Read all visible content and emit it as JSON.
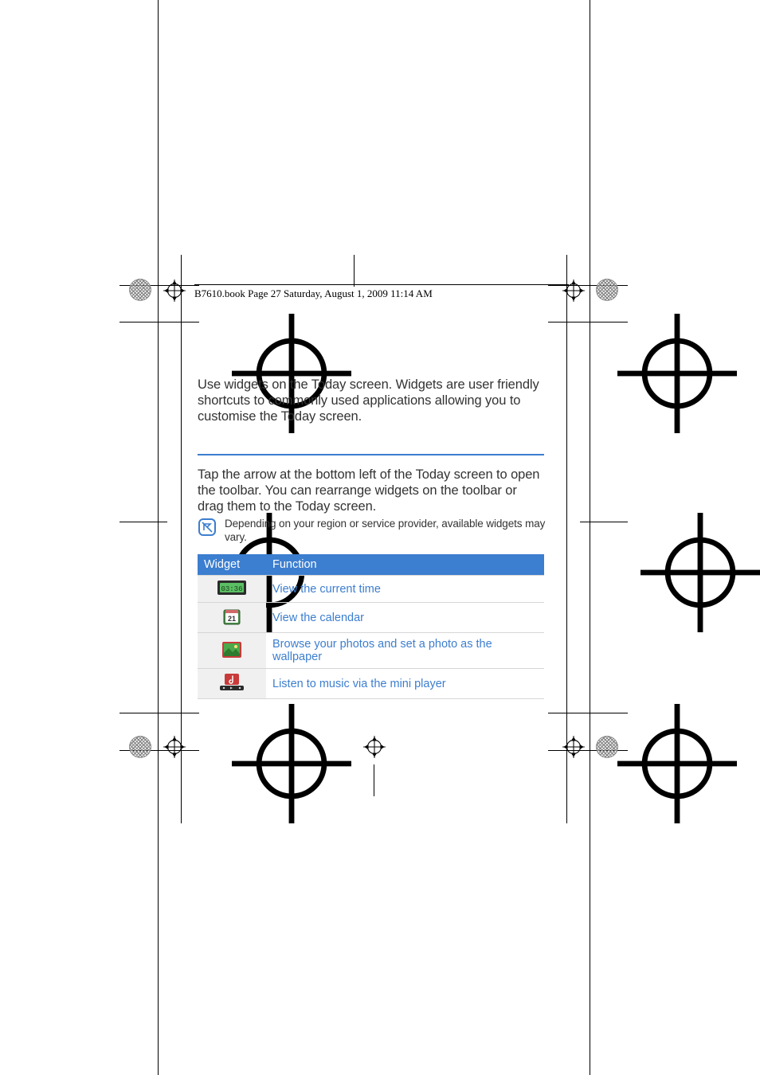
{
  "header": {
    "line": "B7610.book  Page 27  Saturday, August 1, 2009  11:14 AM"
  },
  "body": {
    "intro": "Use widgets on the Today screen. Widgets are user friendly shortcuts to commonly used applications allowing you to customise the Today screen.",
    "toolbar_tip": "Tap the arrow at the bottom left of the Today screen to open the toolbar. You can rearrange widgets on the toolbar or drag them to the Today screen.",
    "note": "Depending on your region or service provider, available widgets may vary."
  },
  "table": {
    "headers": {
      "widget": "Widget",
      "function": "Function"
    },
    "rows": [
      {
        "icon": "clock",
        "function": "View the current time"
      },
      {
        "icon": "calendar",
        "function": "View the calendar"
      },
      {
        "icon": "photo",
        "function": "Browse your photos and set a photo as the wallpaper"
      },
      {
        "icon": "music",
        "function": "Listen to music via the mini player"
      }
    ]
  },
  "icons": {
    "clock_text": "03:36",
    "calendar_text": "21"
  }
}
